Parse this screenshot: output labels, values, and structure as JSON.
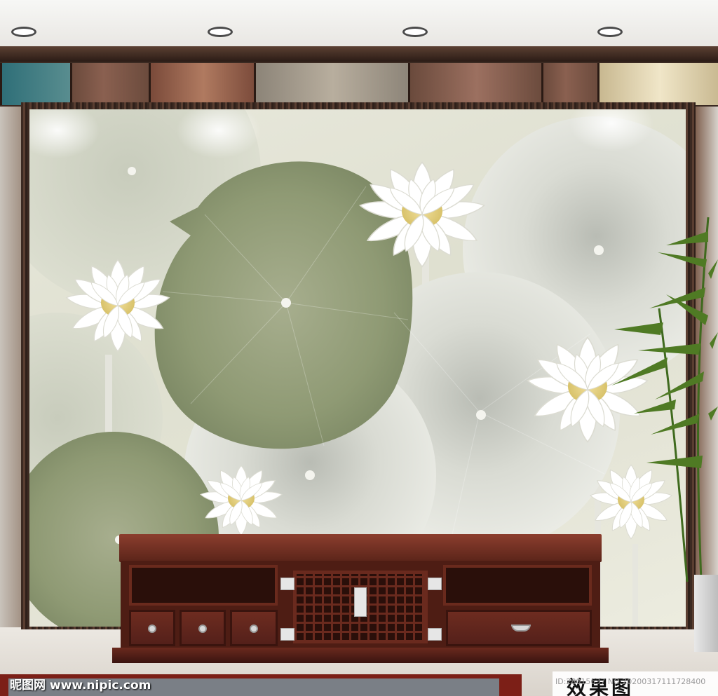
{
  "watermark": {
    "site_text": "昵图网 www.nipic.com",
    "image_id": "ID:28015637 NO:20200317111728400",
    "render_label": "效果图"
  },
  "colors": {
    "frame_wood": "#3c2a22",
    "cabinet_wood": "#5a2419",
    "leaf_green": "#8e9a74",
    "leaf_pale": "#e2e3dc",
    "lotus_white": "#ffffff",
    "lotus_center": "#e8d58a",
    "rug": "#7c1f17"
  }
}
